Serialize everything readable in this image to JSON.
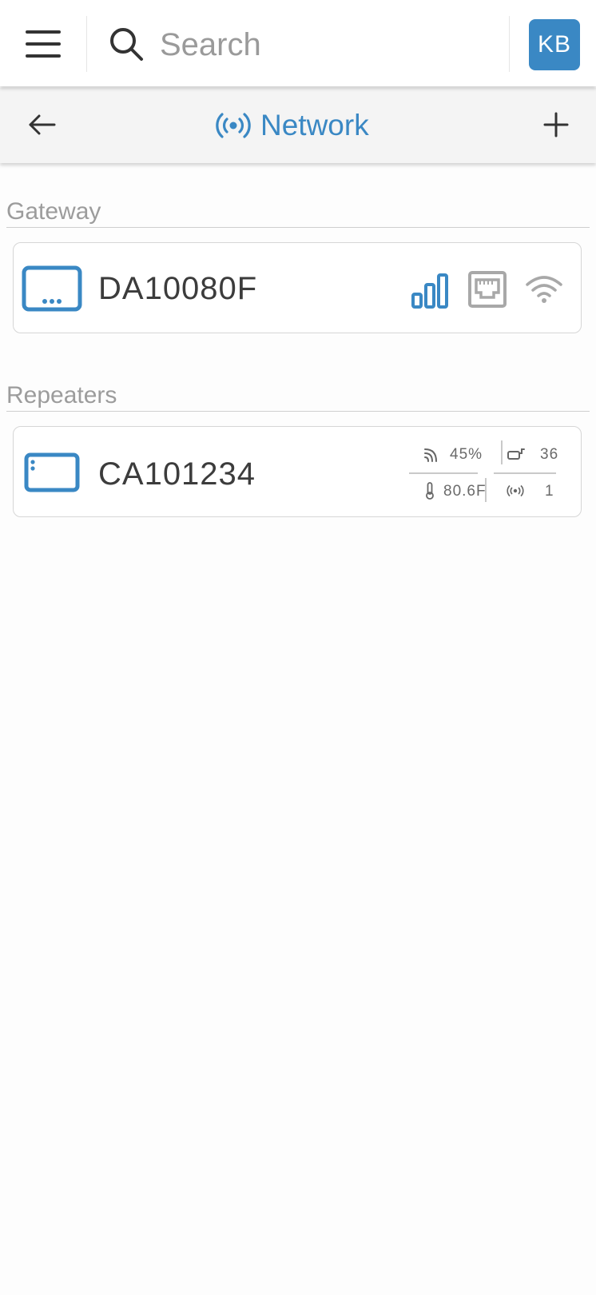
{
  "header": {
    "search_placeholder": "Search",
    "avatar_initials": "KB"
  },
  "subheader": {
    "title": "Network"
  },
  "gateway_section": {
    "label": "Gateway",
    "device": {
      "name": "DA10080F",
      "icons": [
        "cellular-signal-icon",
        "ethernet-port-icon",
        "wifi-icon"
      ]
    }
  },
  "repeaters_section": {
    "label": "Repeaters",
    "device": {
      "name": "CA101234",
      "signal_value": "45%",
      "battery_value": "36",
      "temperature_value": "80.6F",
      "radio_value": "1"
    }
  },
  "colors": {
    "accent": "#3a88c4",
    "muted_text": "#9c9c9c",
    "inactive_icon": "#a8a8a8"
  }
}
